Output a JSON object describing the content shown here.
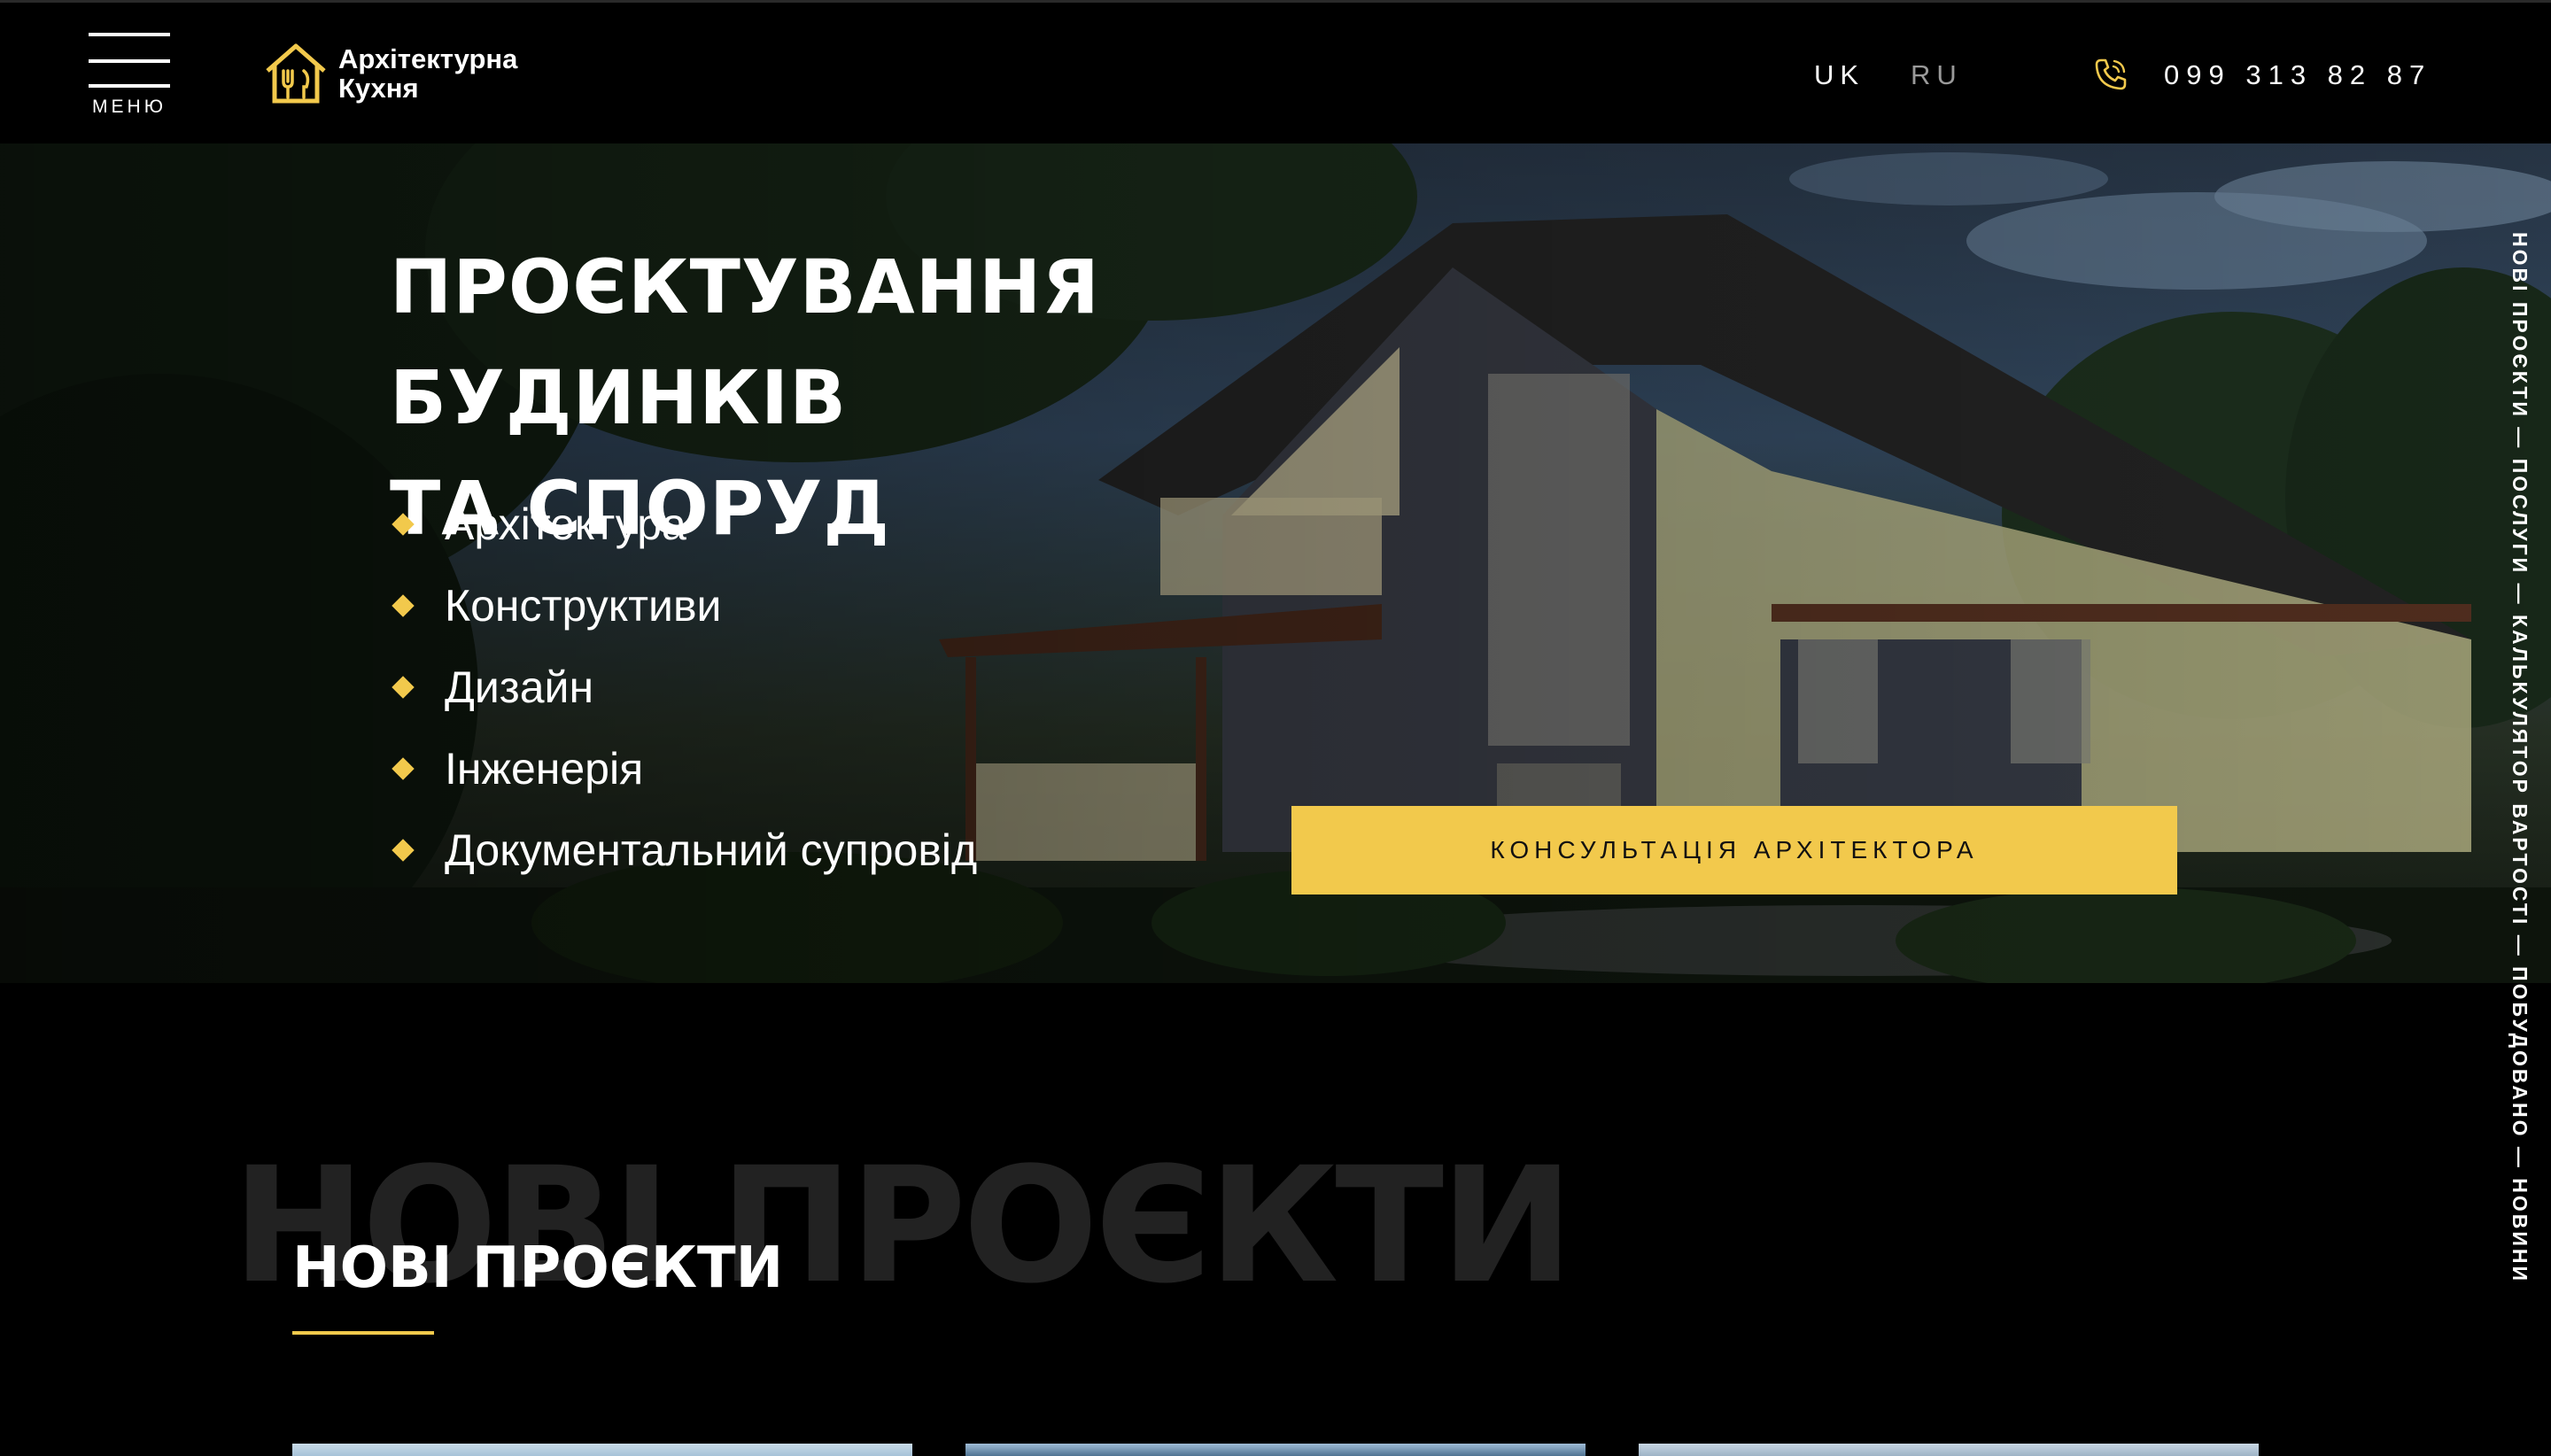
{
  "header": {
    "menu_label": "МЕНЮ",
    "logo_line1": "Архітектурна",
    "logo_line2": "Кухня",
    "lang_uk": "UK",
    "lang_ru": "RU",
    "phone": "099 313 82 87"
  },
  "hero": {
    "title_line1": "ПРОЄКТУВАННЯ БУДИНКІВ",
    "title_line2": "ТА СПОРУД",
    "services": [
      "Архітектура",
      "Конструктиви",
      "Дизайн",
      "Інженерія",
      "Документальний супровід"
    ],
    "cta_label": "КОНСУЛЬТАЦІЯ АРХІТЕКТОРА"
  },
  "sidenav": {
    "items": [
      "НОВІ ПРОЄКТИ",
      "ПОСЛУГИ",
      "КАЛЬКУЛЯТОР ВАРТОСТІ",
      "ПОБУДОВАНО",
      "НОВИНИ"
    ],
    "separator": "—"
  },
  "projects": {
    "bg_title": "НОВІ ПРОЄКТИ",
    "title": "НОВІ ПРОЄКТИ"
  },
  "colors": {
    "accent": "#f2c94c",
    "background": "#000000"
  }
}
